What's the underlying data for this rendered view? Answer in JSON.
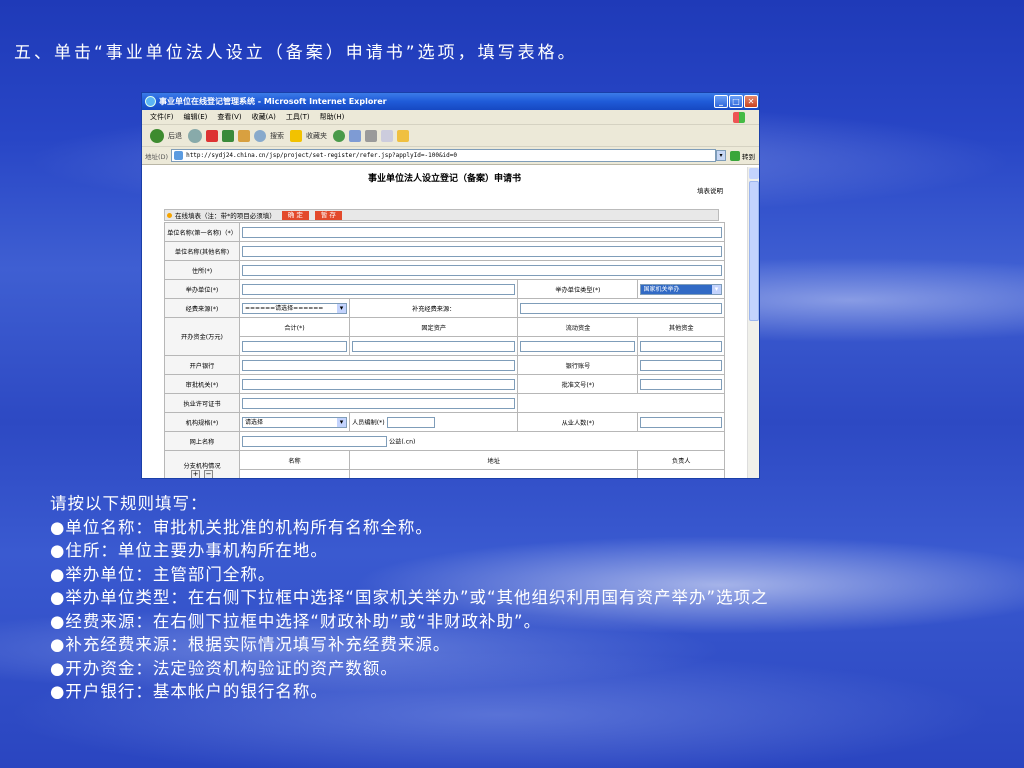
{
  "slide": {
    "title": "五、单击“事业单位法人设立（备案）申请书”选项，填写表格。",
    "rules_heading": "请按以下规则填写：",
    "rules": [
      "●单位名称：审批机关批准的机构所有名称全称。",
      "●住所：单位主要办事机构所在地。",
      "●举办单位：主管部门全称。",
      "●举办单位类型：在右侧下拉框中选择“国家机关举办”或“其他组织利用国有资产举办”选项之",
      "●经费来源：在右侧下拉框中选择“财政补助”或“非财政补助”。",
      "●补充经费来源：根据实际情况填写补充经费来源。",
      "●开办资金：法定验资机构验证的资产数额。",
      "●开户银行：基本帐户的银行名称。"
    ]
  },
  "browser": {
    "window_title": "事业单位在线登记管理系统 - Microsoft Internet Explorer",
    "menu": [
      "文件(F)",
      "编辑(E)",
      "查看(V)",
      "收藏(A)",
      "工具(T)",
      "帮助(H)"
    ],
    "toolbar": {
      "back": "后退",
      "search": "搜索",
      "favorites": "收藏夹"
    },
    "address_label": "地址(D)",
    "address_url": "http://sydj24.china.cn/jsp/project/set-register/refer.jsp?applyId=-100&id=0",
    "go_label": "转到"
  },
  "form": {
    "title": "事业单位法人设立登记（备案）申请书",
    "note": "填表说明",
    "bar_label": "在线填表（注：带*的项目必须填）",
    "confirm_btn": "确 定",
    "save_btn": "暂 存",
    "labels": {
      "name1": "单位名称(第一名称)（*）",
      "name_other": "单位名称(其他名称)",
      "address": "住所(*)",
      "sponsor": "举办单位(*)",
      "sponsor_type": "举办单位类型(*)",
      "funding": "经费来源(*)",
      "extra_funding": "补充经费来源：",
      "capital": "开办资金(万元)",
      "total": "合计(*)",
      "fixed_assets": "固定资产",
      "current_funds": "流动资金",
      "other_funds": "其他资金",
      "bank": "开户银行",
      "bank_account": "银行账号",
      "approval_org": "审批机关(*)",
      "approval_doc": "批准文号(*)",
      "license": "执业许可证书",
      "org_spec": "机构规格(*)",
      "staff_quota": "人员编制(*)",
      "employees": "从业人数(*)",
      "web_name": "网上名称",
      "web_suffix": "公益(.cn)",
      "branches": "分支机构情况",
      "col_name": "名称",
      "col_address": "地址",
      "col_leader": "负责人"
    },
    "values": {
      "sponsor_type_selected": "国家机关举办",
      "funding_selected": "======请选择======",
      "org_spec_selected": "请选择"
    },
    "branch_add": "+",
    "branch_remove": "−"
  }
}
